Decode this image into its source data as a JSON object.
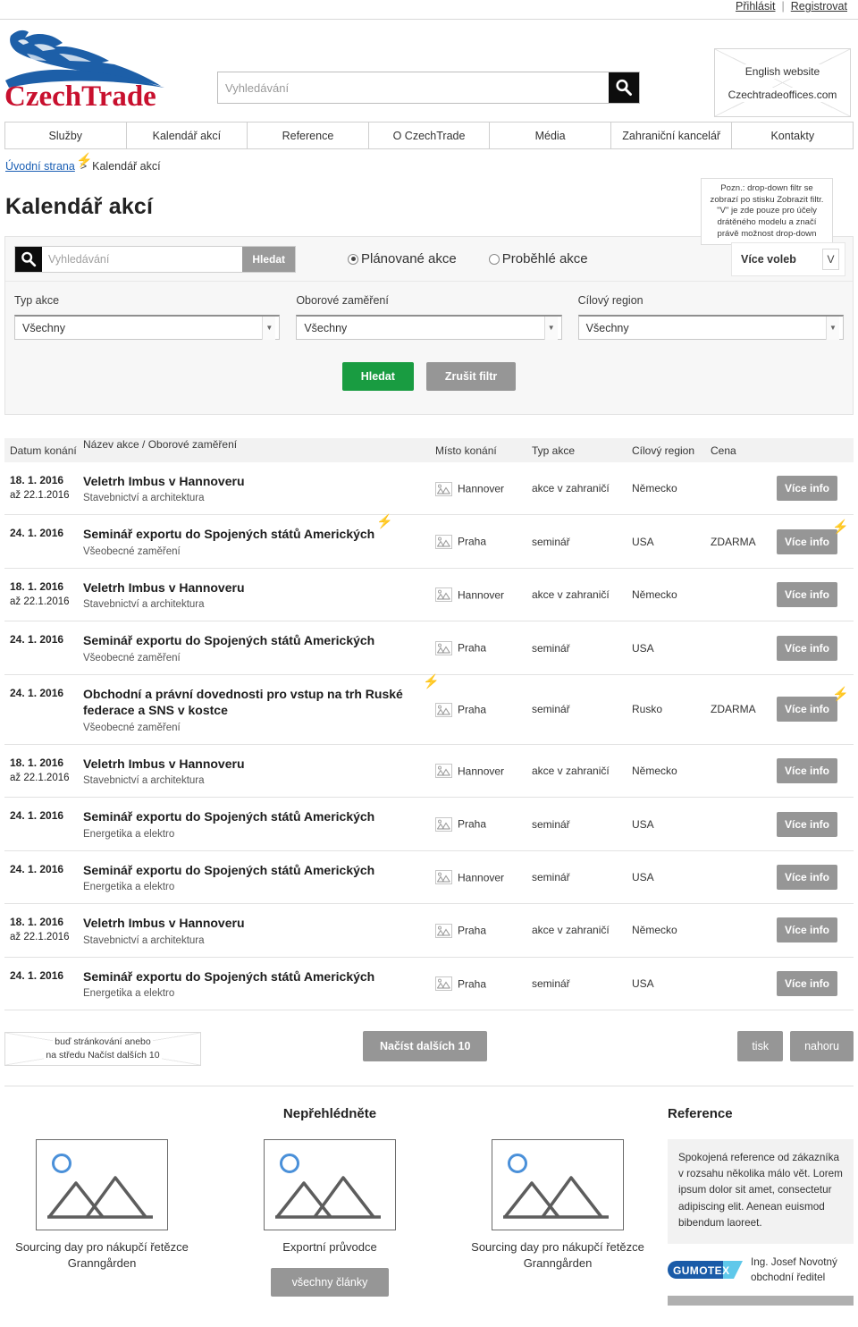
{
  "topbar": {
    "login": "Přihlásit",
    "separator": "|",
    "register": "Registrovat"
  },
  "header": {
    "logo_text": "CzechTrade",
    "search_placeholder": "Vyhledávání",
    "search_value": "",
    "search_icon": "search-icon",
    "language_box": {
      "line1": "English website",
      "line2": "Czechtradeoffices.com"
    }
  },
  "mainnav": {
    "items": [
      "Služby",
      "Kalendář akcí",
      "Reference",
      "O CzechTrade",
      "Média",
      "Zahraniční kancelář",
      "Kontakty"
    ]
  },
  "breadcrumb": {
    "home": "Úvodní strana",
    "separator": ">",
    "current": "Kalendář akcí"
  },
  "page_title": "Kalendář akcí",
  "note_box": {
    "text": "Pozn.: drop-down filtr se zobrazí po stisku Zobrazit filtr. \"V\" je zde pouze pro účely drátěného modelu a značí právě možnost drop-down"
  },
  "filter": {
    "search_placeholder": "Vyhledávání",
    "search_value": "",
    "search_button": "Hledat",
    "radio_planned": "Plánované akce",
    "radio_past": "Proběhlé akce",
    "radio_selected": "planned",
    "more_options_label": "Více voleb",
    "more_options_chevron": "V",
    "fields": [
      {
        "label": "Typ akce",
        "value": "Všechny"
      },
      {
        "label": "Oborové zaměření",
        "value": "Všechny"
      },
      {
        "label": "Cílový region",
        "value": "Všechny"
      }
    ],
    "submit": "Hledat",
    "reset": "Zrušit filtr",
    "submit_color": "#199c41",
    "reset_color": "#969696"
  },
  "table": {
    "headers": {
      "date": "Datum konání",
      "name": "Název akce  /  Oborové zaměření",
      "place": "Místo konání",
      "type": "Typ akce",
      "region": "Cílový region",
      "price": "Cena",
      "action": ""
    },
    "action_label": "Více info",
    "rows": [
      {
        "date1": "18. 1. 2016",
        "date2": "až 22.1.2016",
        "title": "Veletrh Imbus v Hannoveru",
        "subtitle": "Stavebnictví a architektura",
        "place": "Hannover",
        "type": "akce v zahraničí",
        "region": "Německo",
        "price": "",
        "bolt_title": false,
        "bolt_action": false
      },
      {
        "date1": "24. 1. 2016",
        "date2": "",
        "title": "Seminář exportu do Spojených států Amerických",
        "subtitle": "Všeobecné zaměření",
        "place": "Praha",
        "type": "seminář",
        "region": "USA",
        "price": "ZDARMA",
        "bolt_title": true,
        "bolt_action": true
      },
      {
        "date1": "18. 1. 2016",
        "date2": "až 22.1.2016",
        "title": "Veletrh Imbus v Hannoveru",
        "subtitle": "Stavebnictví a architektura",
        "place": "Hannover",
        "type": "akce v zahraničí",
        "region": "Německo",
        "price": "",
        "bolt_title": false,
        "bolt_action": false
      },
      {
        "date1": "24. 1. 2016",
        "date2": "",
        "title": "Seminář exportu do Spojených států Amerických",
        "subtitle": "Všeobecné zaměření",
        "place": "Praha",
        "type": "seminář",
        "region": "USA",
        "price": "",
        "bolt_title": false,
        "bolt_action": false
      },
      {
        "date1": "24. 1. 2016",
        "date2": "",
        "title": "Obchodní a právní dovednosti pro vstup na trh Ruské federace a SNS v kostce",
        "subtitle": "Všeobecné zaměření",
        "place": "Praha",
        "type": "seminář",
        "region": "Rusko",
        "price": "ZDARMA",
        "bolt_title": true,
        "bolt_action": true
      },
      {
        "date1": "18. 1. 2016",
        "date2": "až 22.1.2016",
        "title": "Veletrh Imbus v Hannoveru",
        "subtitle": "Stavebnictví a architektura",
        "place": "Hannover",
        "type": "akce v zahraničí",
        "region": "Německo",
        "price": "",
        "bolt_title": false,
        "bolt_action": false
      },
      {
        "date1": "24. 1. 2016",
        "date2": "",
        "title": "Seminář exportu do Spojených států Amerických",
        "subtitle": "Energetika a elektro",
        "place": "Praha",
        "type": "seminář",
        "region": "USA",
        "price": "",
        "bolt_title": false,
        "bolt_action": false
      },
      {
        "date1": "24. 1. 2016",
        "date2": "",
        "title": "Seminář exportu do Spojených států Amerických",
        "subtitle": "Energetika a elektro",
        "place": "Hannover",
        "type": "seminář",
        "region": "USA",
        "price": "",
        "bolt_title": false,
        "bolt_action": false
      },
      {
        "date1": "18. 1. 2016",
        "date2": "až 22.1.2016",
        "title": "Veletrh Imbus v Hannoveru",
        "subtitle": "Stavebnictví a architektura",
        "place": "Praha",
        "type": "akce v zahraničí",
        "region": "Německo",
        "price": "",
        "bolt_title": false,
        "bolt_action": false
      },
      {
        "date1": "24. 1. 2016",
        "date2": "",
        "title": "Seminář exportu do Spojených států Amerických",
        "subtitle": "Energetika a elektro",
        "place": "Praha",
        "type": "seminář",
        "region": "USA",
        "price": "",
        "bolt_title": false,
        "bolt_action": false
      }
    ]
  },
  "footer_controls": {
    "pagination_note_line1": "buď stránkování anebo",
    "pagination_note_line2": "na středu Načíst dalších 10",
    "load_more": "Načíst dalších 10",
    "print": "tisk",
    "top": "nahoru"
  },
  "bottom": {
    "nepreheadline": "Nepřehlédněte",
    "cards": [
      {
        "caption": "Sourcing day pro nákupčí řetězce Granngården"
      },
      {
        "caption": "Exportní průvodce"
      },
      {
        "caption": "Sourcing day pro nákupčí řetězce Granngården"
      }
    ],
    "all_articles": "všechny články",
    "reference": {
      "headline": "Reference",
      "quote": "Spokojená reference od zákazníka v rozsahu několika málo vět. Lorem ipsum dolor sit amet, consectetur adipiscing elit. Aenean euismod bibendum laoreet.",
      "company_logo_text": "GUMOTEX",
      "author_name": "Ing. Josef Novotný",
      "author_role": "obchodní ředitel"
    }
  },
  "colors": {
    "brand_red": "#c8102e",
    "brand_blue": "#1d5fa8",
    "accent_bolt": "#3eaee0",
    "green": "#199c41",
    "grey_button": "#969696"
  }
}
